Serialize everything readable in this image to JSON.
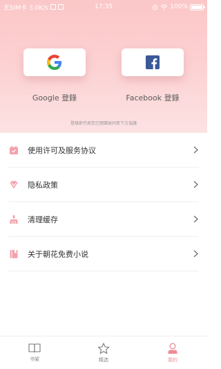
{
  "status_bar": {
    "carrier_text": "无SIM卡 3.0K/s",
    "time": "17:35",
    "battery": "100%"
  },
  "login": {
    "google_label": "Google 登錄",
    "facebook_label": "Facebook 登錄",
    "agreement_note": "登錄即代表您已閱讀並同意下方協議"
  },
  "menu": {
    "items": [
      {
        "label": "使用许可及服务协议",
        "icon": "calendar-icon"
      },
      {
        "label": "隐私政策",
        "icon": "shield-icon"
      },
      {
        "label": "清理缓存",
        "icon": "broom-icon"
      },
      {
        "label": "关于朝花免费小说",
        "icon": "book-icon"
      }
    ]
  },
  "tabbar": {
    "tabs": [
      {
        "label": "书架",
        "icon": "bookshelf-icon",
        "active": false
      },
      {
        "label": "精选",
        "icon": "star-icon",
        "active": false
      },
      {
        "label": "我的",
        "icon": "user-icon",
        "active": true
      }
    ]
  },
  "colors": {
    "header_gradient_top": "#fbc7c8",
    "header_gradient_bottom": "#fde2e3",
    "accent": "#f08a95",
    "menu_icon": "#f3a3ab",
    "facebook_blue": "#3b5998"
  }
}
